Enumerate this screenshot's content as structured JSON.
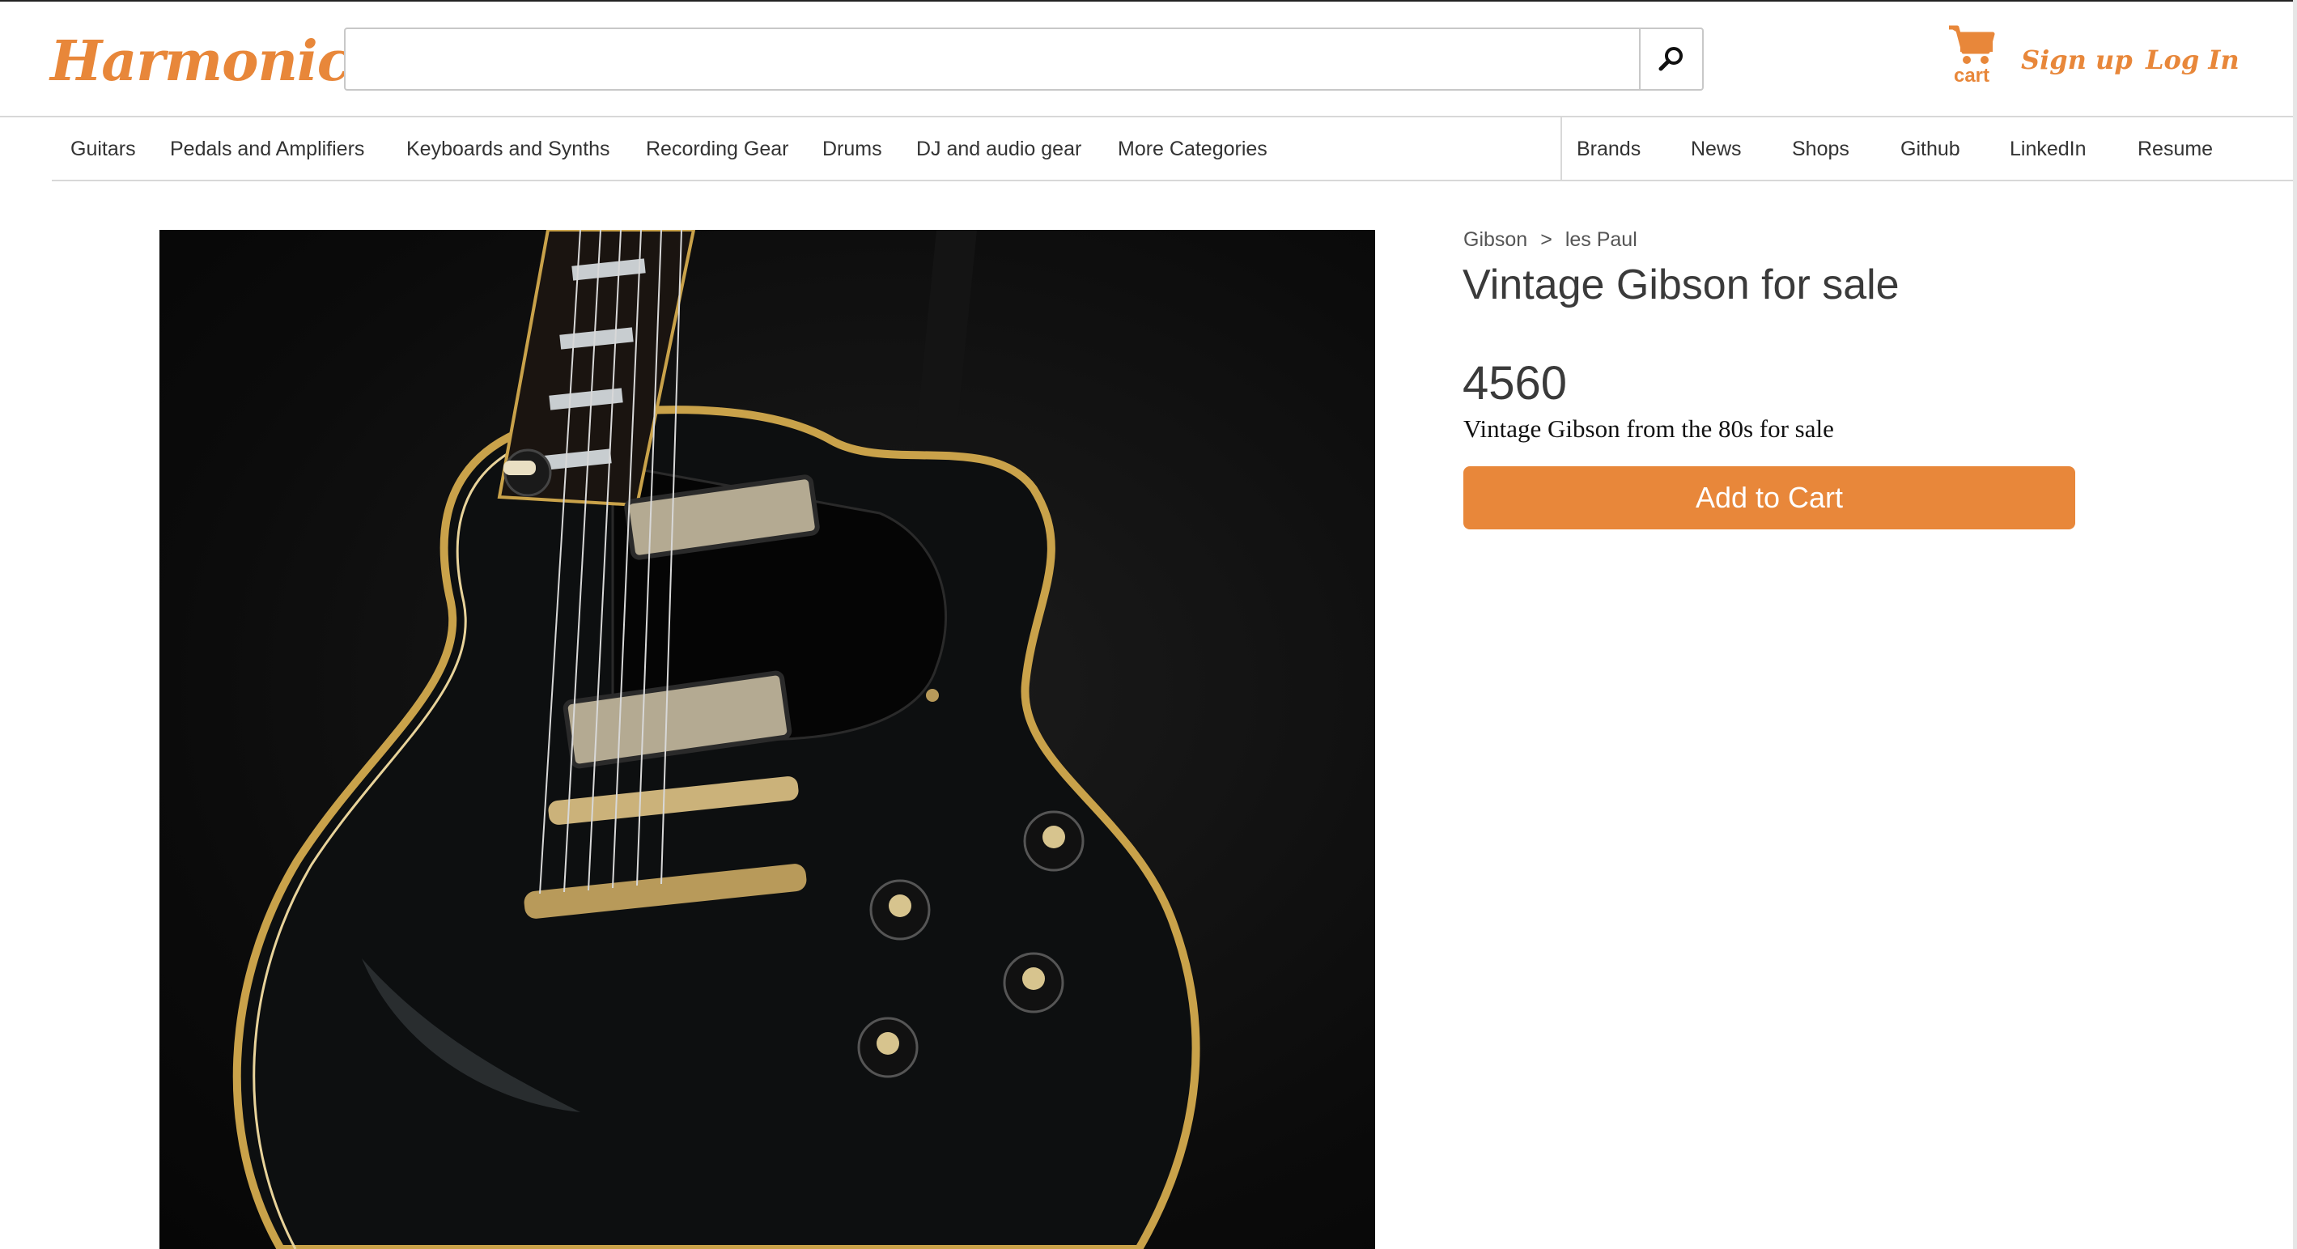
{
  "brand": {
    "logo_text": "Harmonic",
    "accent_color": "#e8873a"
  },
  "header": {
    "search_placeholder": "",
    "search_icon": "search-icon",
    "cart_icon": "cart-icon",
    "cart_label": "cart",
    "signup_label": "Sign up",
    "login_label": "Log In"
  },
  "nav": {
    "categories": [
      "Guitars",
      "Pedals and Amplifiers",
      "Keyboards and Synths",
      "Recording Gear",
      "Drums",
      "DJ and audio gear",
      "More Categories"
    ],
    "links": [
      "Brands",
      "News",
      "Shops",
      "Github",
      "LinkedIn",
      "Resume"
    ]
  },
  "product": {
    "breadcrumb": [
      "Gibson",
      "les Paul"
    ],
    "breadcrumb_separator": ">",
    "title": "Vintage Gibson for sale",
    "price": "4560",
    "description": "Vintage Gibson from the 80s for sale",
    "add_to_cart_label": "Add to Cart",
    "image_subject": "black Gibson Les Paul electric guitar photo"
  }
}
